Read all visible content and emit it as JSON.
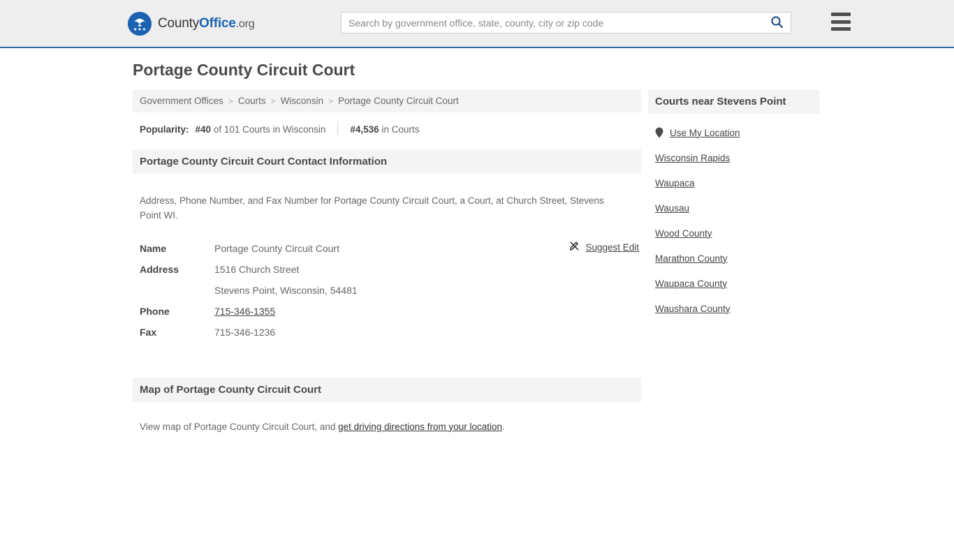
{
  "header": {
    "brand": {
      "part1": "County",
      "part2": "Office",
      "part3": ".org",
      "logo_icon": "eagle-seal-icon"
    },
    "search": {
      "placeholder": "Search by government office, state, county, city or zip code",
      "value": "",
      "icon": "search-icon"
    },
    "menu": {
      "icon": "hamburger-menu-icon",
      "label": "Menu"
    }
  },
  "page": {
    "title": "Portage County Circuit Court"
  },
  "breadcrumb": {
    "items": [
      {
        "label": "Government Offices",
        "current": false
      },
      {
        "label": "Courts",
        "current": false
      },
      {
        "label": "Wisconsin",
        "current": false
      },
      {
        "label": "Portage County Circuit Court",
        "current": true
      }
    ],
    "separator": ">"
  },
  "popularity": {
    "label": "Popularity:",
    "rank_state": "#40",
    "rank_state_text": "of 101 Courts in Wisconsin",
    "rank_overall": "#4,536",
    "rank_overall_text": "in Courts"
  },
  "contact_section": {
    "heading": "Portage County Circuit Court Contact Information",
    "description": "Address, Phone Number, and Fax Number for Portage County Circuit Court, a Court, at Church Street, Stevens Point WI.",
    "suggest_edit": {
      "label": "Suggest Edit",
      "icon": "edit-pencil-icon"
    },
    "rows": [
      {
        "label": "Name",
        "value": "Portage County Circuit Court",
        "link": false
      },
      {
        "label": "Address",
        "value": "1516 Church Street",
        "link": false
      },
      {
        "label": "",
        "value": "Stevens Point, Wisconsin, 54481",
        "link": false
      },
      {
        "label": "Phone",
        "value": "715-346-1355",
        "link": true
      },
      {
        "label": "Fax",
        "value": "715-346-1236",
        "link": false
      }
    ]
  },
  "map_section": {
    "heading": "Map of Portage County Circuit Court",
    "text_before": "View map of Portage County Circuit Court, and ",
    "link_text": "get driving directions from your location",
    "text_after": "."
  },
  "sidebar": {
    "heading": "Courts near Stevens Point",
    "items": [
      {
        "label": "Use My Location",
        "icon": "map-pin-icon"
      },
      {
        "label": "Wisconsin Rapids",
        "icon": ""
      },
      {
        "label": "Waupaca",
        "icon": ""
      },
      {
        "label": "Wausau",
        "icon": ""
      },
      {
        "label": "Wood County",
        "icon": ""
      },
      {
        "label": "Marathon County",
        "icon": ""
      },
      {
        "label": "Waupaca County",
        "icon": ""
      },
      {
        "label": "Waushara County",
        "icon": ""
      }
    ]
  },
  "colors": {
    "brand_blue": "#1b63b0",
    "header_bg": "#eeeeee",
    "header_border": "#2f6ca5",
    "panel_bg": "#f4f4f4",
    "text_dark": "#444444",
    "text_muted": "#666666"
  }
}
